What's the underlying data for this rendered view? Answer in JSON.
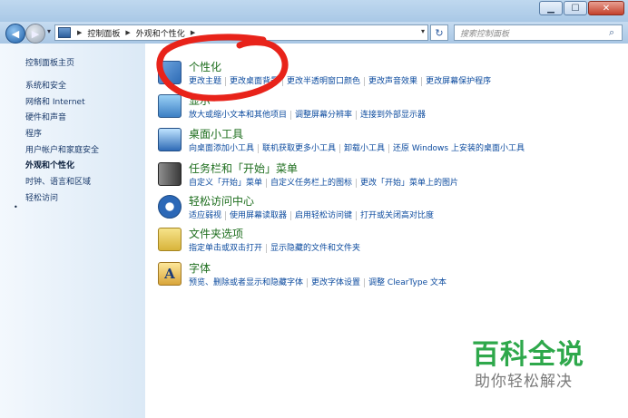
{
  "window_buttons": {
    "minimize": "▁",
    "maximize": "☐",
    "close": "✕"
  },
  "nav": {
    "back": "◀",
    "forward": "▶",
    "dropdown": "▾",
    "refresh": "↻"
  },
  "address": {
    "crumbs": [
      "控制面板",
      "外观和个性化"
    ],
    "separator": "▶",
    "dropdown": "▾"
  },
  "search": {
    "placeholder": "搜索控制面板",
    "icon": "⌕"
  },
  "sidebar": {
    "home": "控制面板主页",
    "items": [
      {
        "label": "系统和安全",
        "active": false
      },
      {
        "label": "网络和 Internet",
        "active": false
      },
      {
        "label": "硬件和声音",
        "active": false
      },
      {
        "label": "程序",
        "active": false
      },
      {
        "label": "用户帐户和家庭安全",
        "active": false
      },
      {
        "label": "外观和个性化",
        "active": true
      },
      {
        "label": "时钟、语言和区域",
        "active": false
      },
      {
        "label": "轻松访问",
        "active": false
      }
    ],
    "bullet": "•"
  },
  "categories": [
    {
      "title": "个性化",
      "icon": "personalization-icon",
      "links": [
        "更改主题",
        "更改桌面背景",
        "更改半透明窗口颜色",
        "更改声音效果",
        "更改屏幕保护程序"
      ]
    },
    {
      "title": "显示",
      "icon": "display-icon",
      "links": [
        "放大或缩小文本和其他项目",
        "调整屏幕分辨率",
        "连接到外部显示器"
      ]
    },
    {
      "title": "桌面小工具",
      "icon": "gadgets-icon",
      "links": [
        "向桌面添加小工具",
        "联机获取更多小工具",
        "卸载小工具",
        "还原 Windows 上安装的桌面小工具"
      ]
    },
    {
      "title": "任务栏和「开始」菜单",
      "icon": "taskbar-icon",
      "links": [
        "自定义「开始」菜单",
        "自定义任务栏上的图标",
        "更改「开始」菜单上的图片"
      ]
    },
    {
      "title": "轻松访问中心",
      "icon": "ease-of-access-icon",
      "links": [
        "适应弱视",
        "使用屏幕读取器",
        "启用轻松访问键",
        "打开或关闭高对比度"
      ]
    },
    {
      "title": "文件夹选项",
      "icon": "folder-options-icon",
      "links": [
        "指定单击或双击打开",
        "显示隐藏的文件和文件夹"
      ]
    },
    {
      "title": "字体",
      "icon": "fonts-icon",
      "glyph": "A",
      "links": [
        "预览、删除或者显示和隐藏字体",
        "更改字体设置",
        "调整 ClearType 文本"
      ]
    }
  ],
  "watermark": {
    "main": "百科全说",
    "sub": "助你轻松解决"
  },
  "colors": {
    "link": "#0b4a9e",
    "category_title": "#1e6e1e",
    "annotation": "#e8231a",
    "watermark": "#2ea84b"
  }
}
